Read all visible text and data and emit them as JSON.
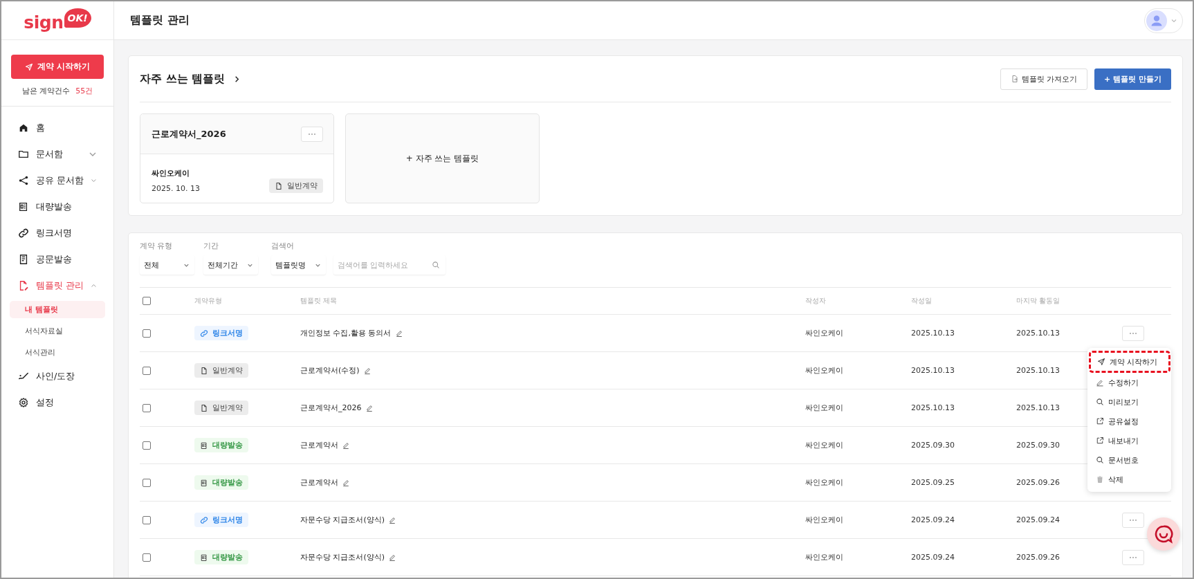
{
  "logo": {
    "text": "sign",
    "badge": "OK!"
  },
  "page_title": "템플릿 관리",
  "sidebar": {
    "start_button": "계약 시작하기",
    "remaining_label": "남은 계약건수",
    "remaining_count": "55건",
    "items": [
      {
        "label": "홈",
        "kind": "home",
        "selected": false
      },
      {
        "label": "문서함",
        "kind": "folder",
        "expanded": false,
        "selected": false
      },
      {
        "label": "공유 문서함",
        "kind": "share",
        "expanded": false,
        "selected": false
      },
      {
        "label": "대량발송",
        "kind": "bulk",
        "selected": false
      },
      {
        "label": "링크서명",
        "kind": "link",
        "selected": false
      },
      {
        "label": "공문발송",
        "kind": "notice",
        "selected": false
      },
      {
        "label": "템플릿 관리",
        "kind": "template",
        "expanded": true,
        "selected": true,
        "children": [
          {
            "label": "내 템플릿",
            "selected": true
          },
          {
            "label": "서식자료실",
            "selected": false
          },
          {
            "label": "서식관리",
            "selected": false
          }
        ]
      },
      {
        "label": "사인/도장",
        "kind": "sign",
        "selected": false
      },
      {
        "label": "설정",
        "kind": "settings",
        "selected": false
      }
    ]
  },
  "favorites": {
    "title": "자주 쓰는 템플릿",
    "import_button": "템플릿 가져오기",
    "create_button": "+ 템플릿 만들기",
    "cards": [
      {
        "title": "근로계약서_2026",
        "author": "싸인오케이",
        "date": "2025. 10. 13",
        "tag": "일반계약",
        "kind": "general"
      }
    ],
    "add_card": "+ 자주 쓰는 템플릿"
  },
  "filters": [
    {
      "label": "계약 유형",
      "value": "전체"
    },
    {
      "label": "기간",
      "value": "전체기간"
    },
    {
      "label": "검색어",
      "value": "템플릿명"
    }
  ],
  "search": {
    "placeholder": "검색어를 입력하세요"
  },
  "table": {
    "select_all": {
      "checked": false
    },
    "columns": [
      "계약유형",
      "템플릿 제목",
      "작성자",
      "작성일",
      "마지막 활동일"
    ],
    "rows": [
      {
        "checked": false,
        "type": "링크서명",
        "kind": "link",
        "title": "개인정보 수집,활용 동의서",
        "author": "싸인오케이",
        "created": "2025.10.13",
        "last_activity": "2025.10.13"
      },
      {
        "checked": false,
        "type": "일반계약",
        "kind": "general",
        "title": "근로계약서(수정)",
        "author": "싸인오케이",
        "created": "2025.10.13",
        "last_activity": "2025.10.13"
      },
      {
        "checked": false,
        "type": "일반계약",
        "kind": "general",
        "title": "근로계약서_2026",
        "author": "싸인오케이",
        "created": "2025.10.13",
        "last_activity": "2025.10.13"
      },
      {
        "checked": false,
        "type": "대량발송",
        "kind": "bulk",
        "title": "근로계약서",
        "author": "싸인오케이",
        "created": "2025.09.30",
        "last_activity": "2025.09.30"
      },
      {
        "checked": false,
        "type": "대량발송",
        "kind": "bulk",
        "title": "근로계약서",
        "author": "싸인오케이",
        "created": "2025.09.25",
        "last_activity": "2025.09.26"
      },
      {
        "checked": false,
        "type": "링크서명",
        "kind": "link",
        "title": "자문수당 지급조서(양식)",
        "author": "싸인오케이",
        "created": "2025.09.24",
        "last_activity": "2025.09.24"
      },
      {
        "checked": false,
        "type": "대량발송",
        "kind": "bulk",
        "title": "자문수당 지급조서(양식)",
        "author": "싸인오케이",
        "created": "2025.09.24",
        "last_activity": "2025.09.26"
      }
    ]
  },
  "row_menu": [
    {
      "label": "계약 시작하기",
      "kind": "send",
      "highlighted": true
    },
    {
      "label": "수정하기",
      "kind": "edit",
      "highlighted": false
    },
    {
      "label": "미리보기",
      "kind": "search",
      "highlighted": false
    },
    {
      "label": "공유설정",
      "kind": "external",
      "highlighted": false
    },
    {
      "label": "내보내기",
      "kind": "external",
      "highlighted": false
    },
    {
      "label": "문서번호",
      "kind": "search",
      "highlighted": false
    },
    {
      "label": "삭제",
      "kind": "delete",
      "highlighted": false
    }
  ]
}
